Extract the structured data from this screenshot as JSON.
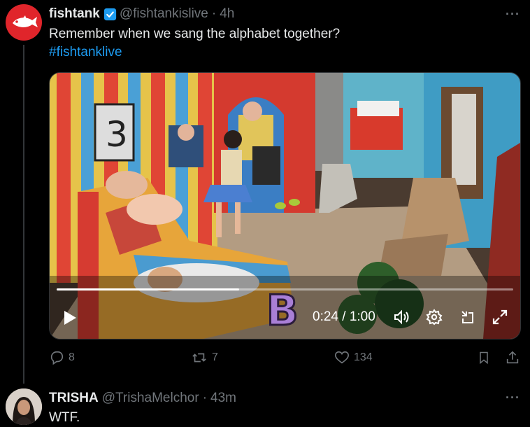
{
  "tweet": {
    "display_name": "fishtank",
    "handle": "@fishtankislive",
    "separator": "·",
    "time": "4h",
    "text": "Remember when we sang the alphabet together?",
    "hashtag": "#fishtanklive",
    "verified": true,
    "more_label": "···"
  },
  "video": {
    "overlay_letter": "B",
    "time_readout": "0:24 / 1:00",
    "progress": 0.4,
    "icons": [
      "play-icon",
      "volume-icon",
      "settings-icon",
      "pip-icon",
      "fullscreen-icon"
    ]
  },
  "actions": {
    "replies": "8",
    "reposts": "7",
    "likes": "134"
  },
  "reply": {
    "display_name": "TRISHA",
    "handle": "@TrishaMelchor",
    "separator": "·",
    "time": "43m",
    "text": "WTF.",
    "more_label": "···"
  },
  "colors": {
    "accent": "#1d9bf0",
    "muted": "#71767b",
    "brand_red": "#e0252b"
  }
}
